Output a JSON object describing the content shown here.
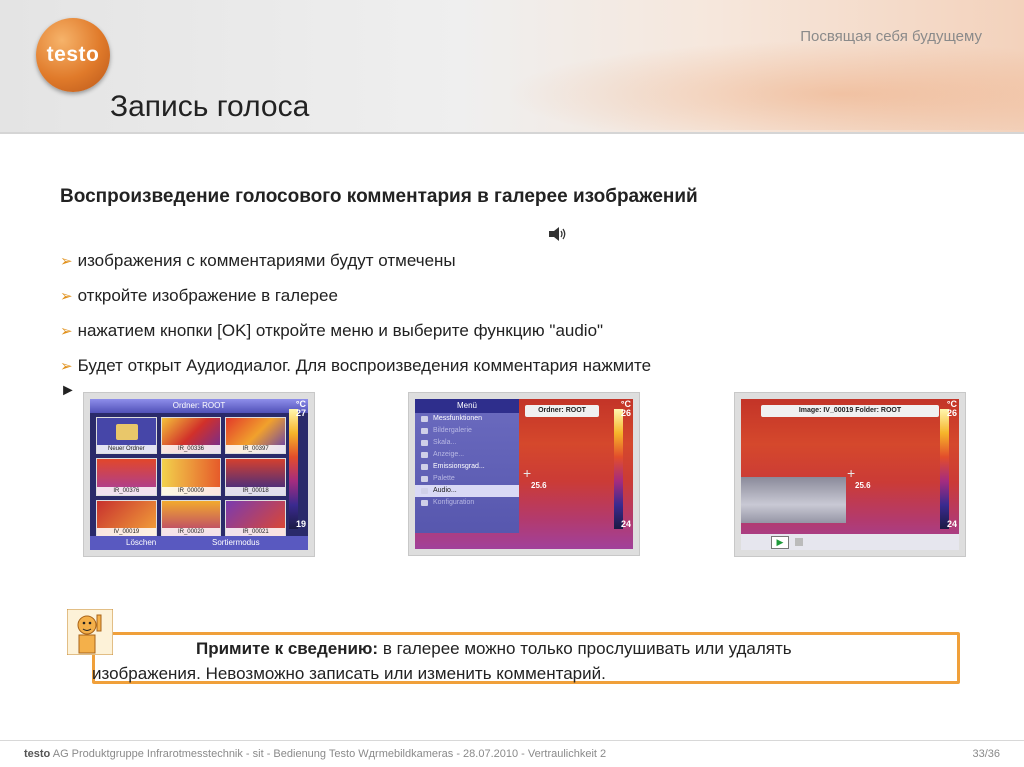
{
  "header": {
    "logo_text": "testo",
    "slogan": "Посвящая себя будущему",
    "title": "Запись голоса"
  },
  "section": {
    "heading": "Воспроизведение голосового комментария в галерее изображений",
    "bullets": [
      "изображения с комментариями будут отмечены",
      "откройте изображение в галерее",
      "нажатием кнопки [OK] откройте меню и выберите функцию \"audio\"",
      "Будет открыт Аудиодиалог. Для воспроизведения комментария нажмите"
    ],
    "play_symbol": "►"
  },
  "screenshots": {
    "gallery": {
      "title": "Ordner: ROOT",
      "cells": [
        "Neuer Ordner",
        "IR_00336",
        "IR_00397",
        "IR_00376",
        "IR_00009",
        "IR_00018",
        "IV_00019",
        "IR_00020",
        "IR_00021"
      ],
      "btn_left": "Löschen",
      "btn_right": "Sortiermodus",
      "unit": "°C",
      "scale_max": "27",
      "scale_min": "19"
    },
    "menu": {
      "menu_title": "Menü",
      "items": [
        "Messfunktionen",
        "Bildergalerie",
        "Skala...",
        "Anzeige...",
        "Emissionsgrad...",
        "Palette",
        "Audio...",
        "Konfiguration"
      ],
      "folder_label": "Ordner: ROOT",
      "temp": "25.6",
      "unit": "°C",
      "scale_max": "26",
      "scale_min": "24"
    },
    "audio": {
      "top_label": "Image: IV_00019   Folder: ROOT",
      "temp": "25.6",
      "unit": "°C",
      "scale_max": "26",
      "scale_min": "24",
      "play_glyph": "▶"
    }
  },
  "notice": {
    "bold": "Примите к сведению:",
    "text1": " в галерее можно только прослушивать или удалять",
    "text2": "изображения. Невозможно записать или изменить комментарий."
  },
  "footer": {
    "brand": "testo",
    "text": " AG Produktgruppe Infrarotmesstechnik - sit - Bedienung Testo Wдrmebildkameras - 28.07.2010 - Vertraulichkeit 2",
    "page": "33/36"
  },
  "colors": {
    "accent": "#f0a03a",
    "logo": "#e07a2a"
  }
}
